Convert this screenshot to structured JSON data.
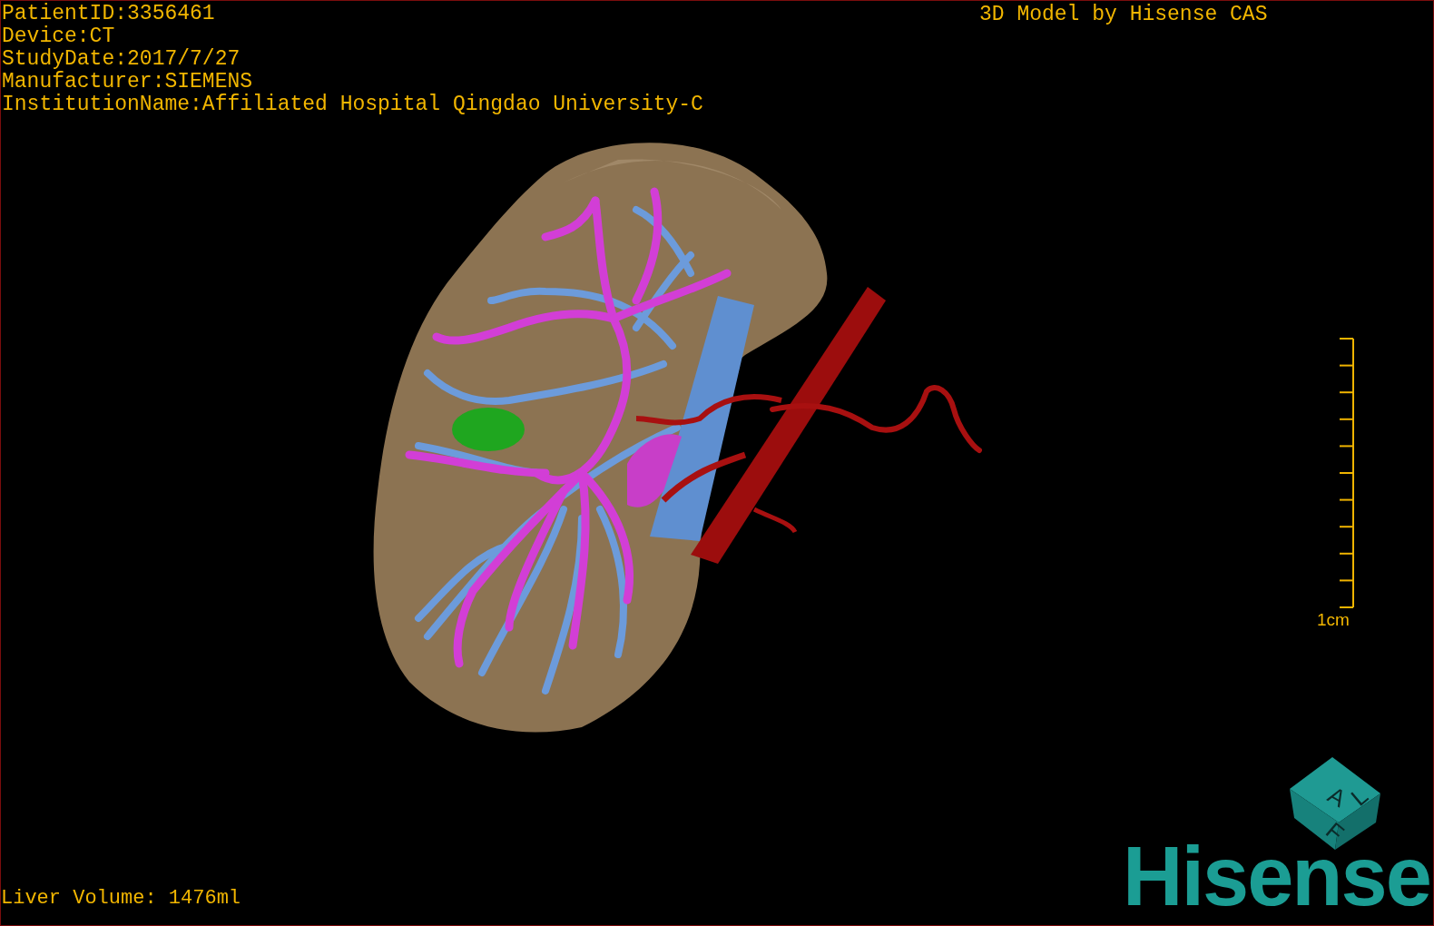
{
  "info_lines": [
    "PatientID:3356461",
    "Device:CT",
    "StudyDate:2017/7/27",
    "Manufacturer:SIEMENS",
    "InstitutionName:Affiliated Hospital Qingdao University-C"
  ],
  "title": "3D Model by Hisense CAS",
  "scale_bar": {
    "label": "1cm"
  },
  "orientation_cube": {
    "faces": [
      "A",
      "L",
      "F"
    ]
  },
  "logo": "Hisense",
  "liver_volume": "Liver Volume: 1476ml"
}
